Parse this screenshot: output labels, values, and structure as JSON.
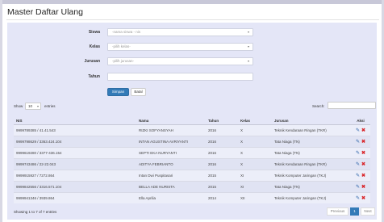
{
  "page": {
    "title": "Master Daftar Ulang"
  },
  "form": {
    "siswa_label": "Siswa",
    "siswa_value": "-nama siswa - nis",
    "kelas_label": "Kelas",
    "kelas_value": "-pilih kelas-",
    "jurusan_label": "Jurusan",
    "jurusan_value": "-pilih jurusan-",
    "tahun_label": "Tahun",
    "tahun_value": "",
    "save_label": "Simpan",
    "cancel_label": "Batal"
  },
  "table_controls": {
    "show_label": "Show",
    "entries_value": "10",
    "entries_label": "entries",
    "search_label": "Search:"
  },
  "table": {
    "columns": [
      "NIS",
      "Nama",
      "Tahun",
      "Kelas",
      "Jurusan",
      "Aksi"
    ],
    "rows": [
      {
        "nis": "9999789385 / 41.41.543",
        "nama": "RIZKI SOFYANSYAH",
        "tahun": "2016",
        "kelas": "X",
        "jurusan": "Teknik Kendaraan Ringan (TKR)"
      },
      {
        "nis": "9999798629 / 3363.424.104",
        "nama": "INTAN AGUSTINA AVRIYANTI",
        "tahun": "2016",
        "kelas": "X",
        "jurusan": "Tata Niaga (TN)"
      },
      {
        "nis": "9999619280 / 3377-436.154",
        "nama": "SEPTI EKA NURYANTI",
        "tahun": "2016",
        "kelas": "X",
        "jurusan": "Tata Niaga (TN)"
      },
      {
        "nis": "9999743486 / 22-22.043",
        "nama": "ADITYA FEBRIANTO",
        "tahun": "2016",
        "kelas": "X",
        "jurusan": "Teknik Kendaraan Ringan (TKR)"
      },
      {
        "nis": "9999915927 / 7272.864",
        "nama": "Intan Dwi Puspitasari",
        "tahun": "2015",
        "kelas": "XI",
        "jurusan": "Teknik Komputer Jaringan (TKJ)"
      },
      {
        "nis": "9999842556 / 3316.571.104",
        "nama": "BELLA ADE NURISTA",
        "tahun": "2015",
        "kelas": "XI",
        "jurusan": "Tata Niaga (TN)"
      },
      {
        "nis": "9999941346 / 3939.864",
        "nama": "Ella Aprilia",
        "tahun": "2014",
        "kelas": "XII",
        "jurusan": "Teknik Komputer Jaringan (TKJ)"
      }
    ]
  },
  "footer": {
    "info": "Showing 1 to 7 of 7 entries",
    "previous_label": "Previous",
    "page_number": "1",
    "next_label": "Next"
  },
  "icons": {
    "edit": "edit-icon",
    "delete": "delete-icon"
  },
  "colors": {
    "primary": "#337ab7",
    "panel": "#e4e6f7",
    "delete": "#d9262a"
  }
}
